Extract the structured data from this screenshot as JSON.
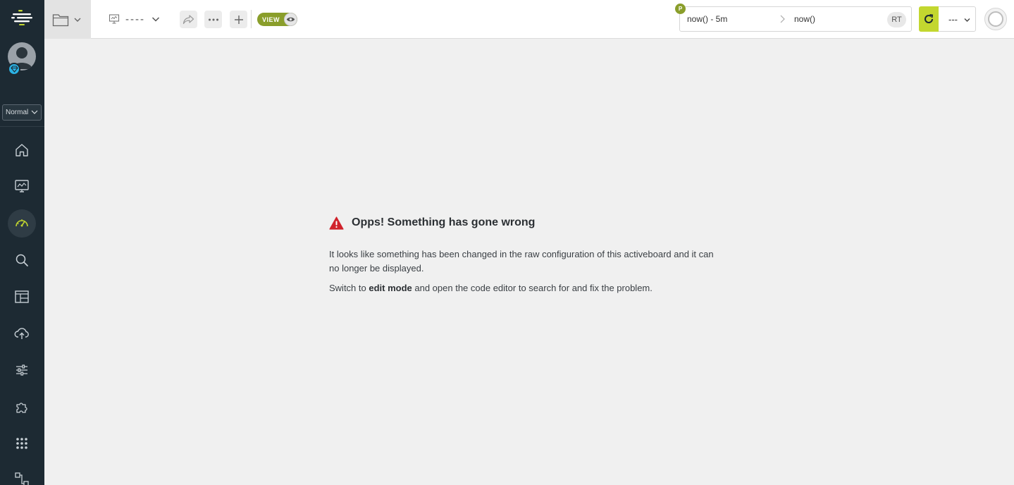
{
  "sidebar": {
    "mode_select": "Normal",
    "icons": [
      "home-icon",
      "monitor-icon",
      "dashboard-icon",
      "search-icon",
      "layout-icon",
      "cloud-upload-icon",
      "sliders-icon",
      "puzzle-icon",
      "apps-grid-icon",
      "workflow-icon"
    ],
    "active_item": "dashboard-icon"
  },
  "header": {
    "board_name": "----",
    "view_toggle_label": "VIEW",
    "time_range": {
      "badge": "P",
      "from": "now() - 5m",
      "to": "now()",
      "realtime_label": "RT"
    },
    "refresh_interval": "---"
  },
  "error": {
    "title": "Opps! Something has gone wrong",
    "paragraph1": "It looks like something has been changed in the raw configuration of this activeboard and it can no longer be displayed.",
    "paragraph2_prefix": "Switch to ",
    "paragraph2_bold": "edit mode",
    "paragraph2_suffix": " and open the code editor to search for and fix the problem."
  },
  "colors": {
    "sidebar_bg": "#1d2a33",
    "accent_green": "#8a9e2b",
    "refresh_yellow": "#c3d72f",
    "error_red": "#d0222b",
    "badge_blue": "#2bb3e6"
  }
}
